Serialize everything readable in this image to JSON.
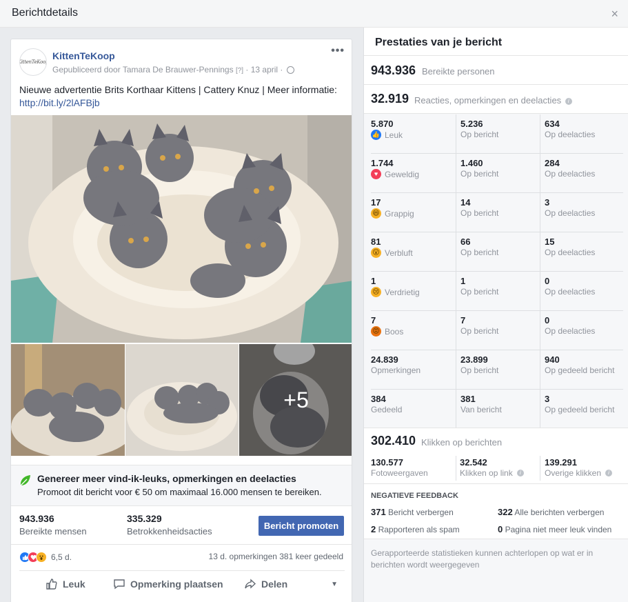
{
  "dialog": {
    "title": "Berichtdetails",
    "close": "×"
  },
  "post": {
    "page_name": "KittenTeKoop",
    "avatar_text": "KittenTeKoop",
    "meta": "Gepubliceerd door Tamara De Brauwer-Pennings",
    "meta_help": "[?]",
    "date": "· 13 april ·",
    "text": "Nieuwe advertentie Brits Korthaar Kittens | Cattery Knuz | Meer informatie:",
    "link": "http://bit.ly/2lAFBjb",
    "more_photos": "+5",
    "menu": "•••"
  },
  "promo": {
    "title": "Genereer meer vind-ik-leuks, opmerkingen en deelacties",
    "subtitle": "Promoot dit bericht voor € 50 om maximaal 16.000 mensen te bereiken."
  },
  "summary": {
    "reach_value": "943.936",
    "reach_label": "Bereikte mensen",
    "engagement_value": "335.329",
    "engagement_label": "Betrokkenheidsacties",
    "promote_button": "Bericht promoten"
  },
  "social": {
    "reaction_count": "6,5 d.",
    "comments_shares": "13 d. opmerkingen  381 keer gedeeld"
  },
  "actions": {
    "like": "Leuk",
    "comment": "Opmerking plaatsen",
    "share": "Delen"
  },
  "panel": {
    "title": "Prestaties van je bericht",
    "reached_value": "943.936",
    "reached_label": "Bereikte personen",
    "reactions_value": "32.919",
    "reactions_label": "Reacties, opmerkingen en deelacties",
    "rows": [
      {
        "label": "Leuk",
        "emoji": "like",
        "color": "#2078f4",
        "total": "5.870",
        "post": "5.236",
        "post_label": "Op bericht",
        "shares": "634",
        "shares_label": "Op deelacties"
      },
      {
        "label": "Geweldig",
        "emoji": "love",
        "color": "#f33e58",
        "total": "1.744",
        "post": "1.460",
        "post_label": "Op bericht",
        "shares": "284",
        "shares_label": "Op deelacties"
      },
      {
        "label": "Grappig",
        "emoji": "haha",
        "color": "#f7b125",
        "total": "17",
        "post": "14",
        "post_label": "Op bericht",
        "shares": "3",
        "shares_label": "Op deelacties"
      },
      {
        "label": "Verbluft",
        "emoji": "wow",
        "color": "#f7b125",
        "total": "81",
        "post": "66",
        "post_label": "Op bericht",
        "shares": "15",
        "shares_label": "Op deelacties"
      },
      {
        "label": "Verdrietig",
        "emoji": "sad",
        "color": "#f7b125",
        "total": "1",
        "post": "1",
        "post_label": "Op bericht",
        "shares": "0",
        "shares_label": "Op deelacties"
      },
      {
        "label": "Boos",
        "emoji": "angry",
        "color": "#e9710f",
        "total": "7",
        "post": "7",
        "post_label": "Op bericht",
        "shares": "0",
        "shares_label": "Op deelacties"
      },
      {
        "label": "Opmerkingen",
        "emoji": "",
        "color": "",
        "total": "24.839",
        "post": "23.899",
        "post_label": "Op bericht",
        "shares": "940",
        "shares_label": "Op gedeeld bericht"
      },
      {
        "label": "Gedeeld",
        "emoji": "",
        "color": "",
        "total": "384",
        "post": "381",
        "post_label": "Van bericht",
        "shares": "3",
        "shares_label": "Op gedeeld bericht"
      }
    ],
    "clicks_value": "302.410",
    "clicks_label": "Klikken op berichten",
    "clicks": [
      {
        "value": "130.577",
        "label": "Fotoweergaven"
      },
      {
        "value": "32.542",
        "label": "Klikken op link"
      },
      {
        "value": "139.291",
        "label": "Overige klikken"
      }
    ],
    "negative_title": "NEGATIEVE FEEDBACK",
    "negative": [
      {
        "value": "371",
        "label": "Bericht verbergen"
      },
      {
        "value": "322",
        "label": "Alle berichten verbergen"
      },
      {
        "value": "2",
        "label": "Rapporteren als spam"
      },
      {
        "value": "0",
        "label": "Pagina niet meer leuk vinden"
      }
    ],
    "footnote": "Gerapporteerde statistieken kunnen achterlopen op wat er in berichten wordt weergegeven"
  }
}
